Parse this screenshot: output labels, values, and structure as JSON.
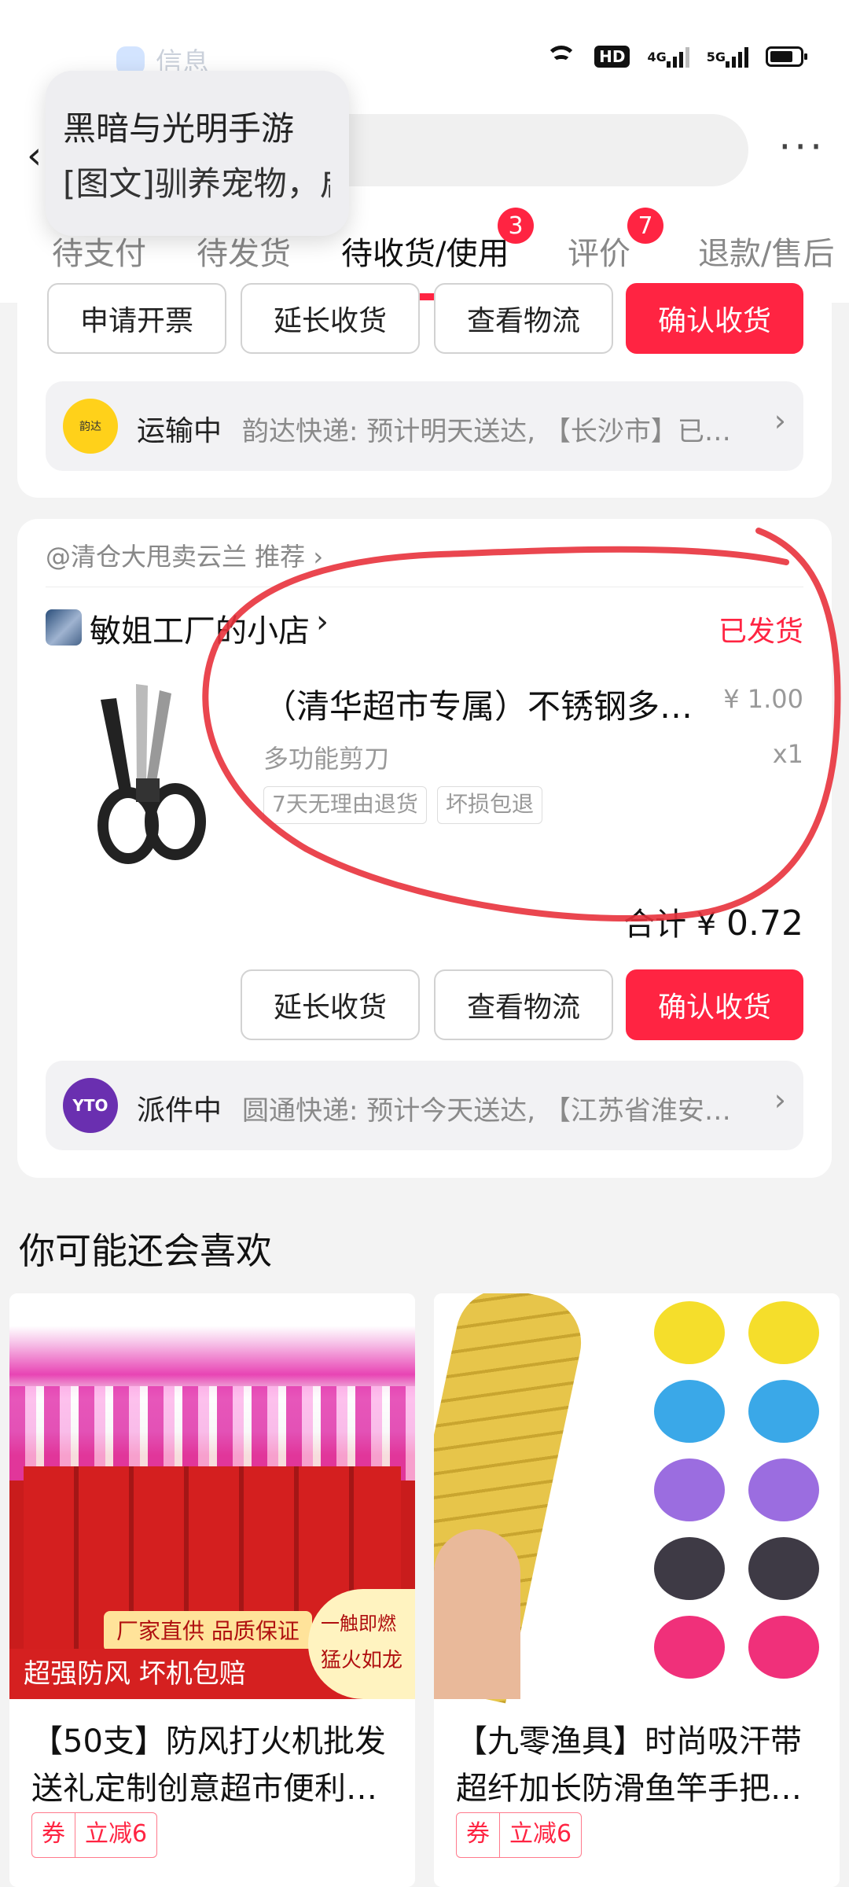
{
  "status_bar": {
    "hd_label": "HD",
    "net1": "4G",
    "net2": "5G"
  },
  "background_app": {
    "label": "信息"
  },
  "notification": {
    "title": "黑暗与光明手游",
    "body": "[图文]驯养宠物，启"
  },
  "header": {
    "back_icon": "chevron-left-icon",
    "more_label": "···"
  },
  "tabs": [
    {
      "label": "待支付"
    },
    {
      "label": "待发货"
    },
    {
      "label": "待收货/使用",
      "badge": "3",
      "active": true
    },
    {
      "label": "评价",
      "badge": "7"
    },
    {
      "label": "退款/售后"
    }
  ],
  "order1": {
    "buttons": [
      "申请开票",
      "延长收货",
      "查看物流",
      "确认收货"
    ],
    "logistics": {
      "status": "运输中",
      "text": "韵达快递: 预计明天送达, 【长沙市】已…",
      "logo_text": "韵达"
    }
  },
  "order2": {
    "recommend": "@清仓大甩卖云兰 推荐",
    "shop_name": "敏姐工厂的小店",
    "status": "已发货",
    "product": {
      "title": "（清华超市专属）不锈钢多…",
      "price": "¥ 1.00",
      "spec": "多功能剪刀",
      "qty": "x1",
      "tags": [
        "7天无理由退货",
        "坏损包退"
      ]
    },
    "total_label": "合计 ¥",
    "total_value": "0.72",
    "buttons": [
      "延长收货",
      "查看物流",
      "确认收货"
    ],
    "logistics": {
      "status": "派件中",
      "text": "圆通快递: 预计今天送达, 【江苏省淮安…",
      "logo_text": "YTO"
    }
  },
  "recommendations": {
    "title": "你可能还会喜欢",
    "items": [
      {
        "title": "【50支】防风打火机批发送礼定制创意超市便利…",
        "coupon_tag": "券",
        "coupon_value": "立减6",
        "banner1": "厂家直供 品质保证",
        "banner2": "超强防风 坏机包赔",
        "badge1": "一触即燃",
        "badge2": "猛火如龙"
      },
      {
        "title": "【九零渔具】时尚吸汗带超纤加长防滑鱼竿手把…",
        "coupon_tag": "券",
        "coupon_value": "立减6"
      }
    ]
  },
  "colors": {
    "accent": "#ff2442",
    "annotation": "#e8323c"
  }
}
